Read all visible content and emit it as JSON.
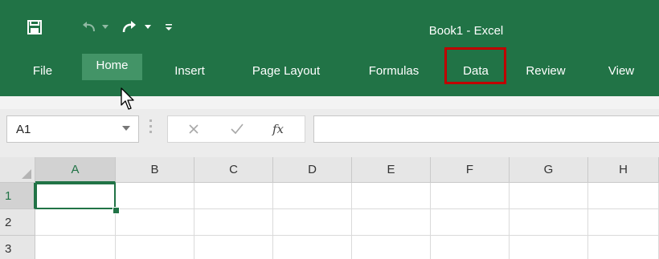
{
  "window": {
    "title": "Book1 - Excel"
  },
  "quick_access": {
    "save_icon": "save-icon",
    "undo_icon": "undo-icon",
    "redo_icon": "redo-icon",
    "customize_icon": "customize-qat-icon"
  },
  "ribbon": {
    "tabs": [
      {
        "label": "File"
      },
      {
        "label": "Home",
        "active": true
      },
      {
        "label": "Insert"
      },
      {
        "label": "Page Layout"
      },
      {
        "label": "Formulas"
      },
      {
        "label": "Data",
        "highlighted": true
      },
      {
        "label": "Review"
      },
      {
        "label": "View"
      }
    ],
    "highlight_color": "#c00000"
  },
  "formula_bar": {
    "name_box_value": "A1",
    "cancel_icon": "close-icon",
    "enter_icon": "checkmark-icon",
    "function_label": "fx",
    "formula_value": ""
  },
  "grid": {
    "columns": [
      "A",
      "B",
      "C",
      "D",
      "E",
      "F",
      "G",
      "H"
    ],
    "rows": [
      "1",
      "2",
      "3"
    ],
    "selected_cell": "A1"
  },
  "colors": {
    "excel_green": "#217346",
    "active_tab_bg": "#439467",
    "header_bg": "#e6e6e6"
  }
}
